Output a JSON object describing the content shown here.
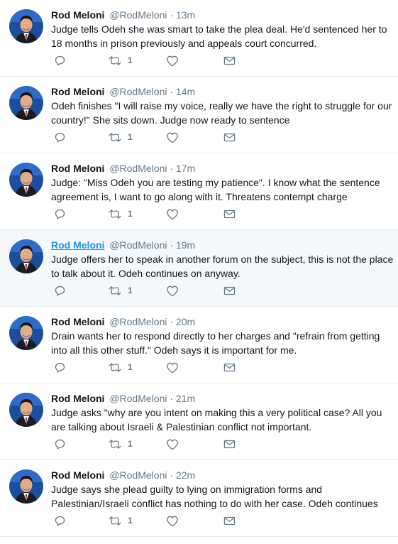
{
  "colors": {
    "accent": "#1b95e0",
    "muted": "#657786",
    "text": "#14171a",
    "divider": "#e6ecf0",
    "hover_bg": "#f5f8fa"
  },
  "tweets": [
    {
      "name": "Rod Meloni",
      "handle": "@RodMeloni",
      "separator": "·",
      "time": "13m",
      "text": "Judge tells Odeh she was smart to take the plea deal. He'd sentenced her to 18 months in prison previously and appeals court concurred.",
      "retweets": "1",
      "hovered": false
    },
    {
      "name": "Rod Meloni",
      "handle": "@RodMeloni",
      "separator": "·",
      "time": "14m",
      "text": "Odeh finishes \"I will raise my voice, really we have the right to struggle for our country!\" She sits down. Judge now ready to sentence",
      "retweets": "1",
      "hovered": false
    },
    {
      "name": "Rod Meloni",
      "handle": "@RodMeloni",
      "separator": "·",
      "time": "17m",
      "text": "Judge: \"Miss Odeh you are testing my patience\". I know what the sentence agreement is, I want to go along with it. Threatens contempt charge",
      "retweets": "1",
      "hovered": false
    },
    {
      "name": "Rod Meloni",
      "handle": "@RodMeloni",
      "separator": "·",
      "time": "19m",
      "text": "Judge offers her to speak in another forum on the subject, this is not the place to talk about it. Odeh continues on anyway.",
      "retweets": "1",
      "hovered": true
    },
    {
      "name": "Rod Meloni",
      "handle": "@RodMeloni",
      "separator": "·",
      "time": "20m",
      "text": "Drain wants her to respond directly to her charges and \"refrain from getting into all this other stuff.\" Odeh says it is important for me.",
      "retweets": "1",
      "hovered": false
    },
    {
      "name": "Rod Meloni",
      "handle": "@RodMeloni",
      "separator": "·",
      "time": "21m",
      "text": "Judge asks \"why are you intent on making this a very political case? All you are talking about Israeli & Palestinian conflict not important.",
      "retweets": "1",
      "hovered": false
    },
    {
      "name": "Rod Meloni",
      "handle": "@RodMeloni",
      "separator": "·",
      "time": "22m",
      "text": "Judge says she plead guilty to lying on immigration forms and Palestinian/Israeli conflict has nothing to do with her case. Odeh continues",
      "retweets": "1",
      "hovered": false
    }
  ]
}
